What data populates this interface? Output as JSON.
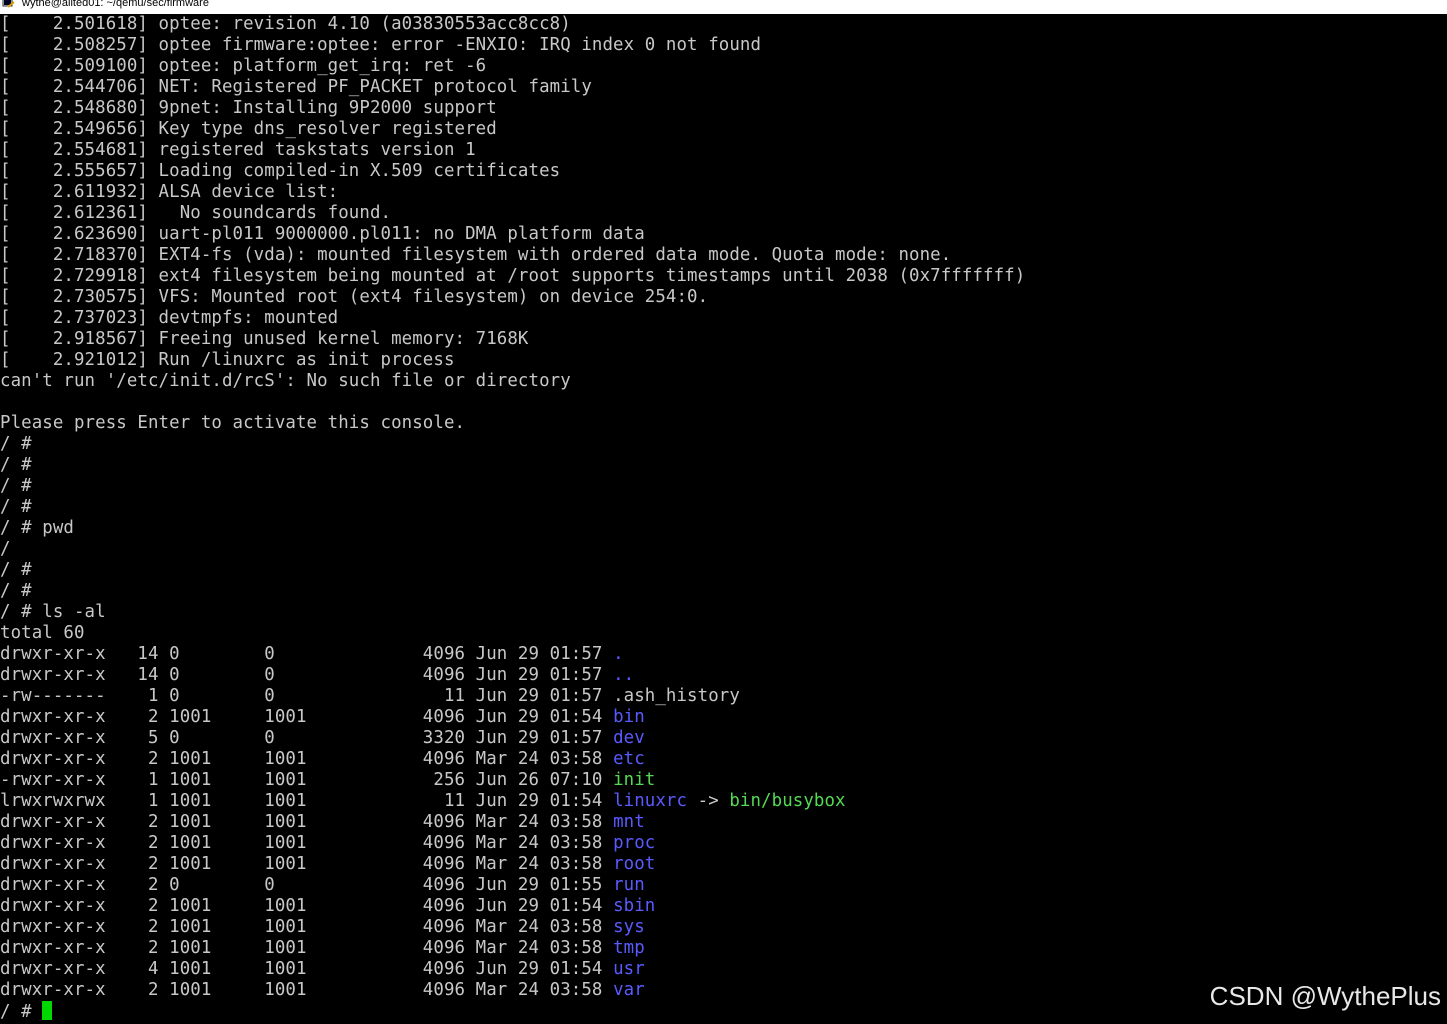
{
  "window": {
    "title": "wythe@alited01: ~/qemu/sec/firmware"
  },
  "terminal": {
    "boot_log": [
      "[    2.501618] optee: revision 4.10 (a03830553acc8cc8)",
      "[    2.508257] optee firmware:optee: error -ENXIO: IRQ index 0 not found",
      "[    2.509100] optee: platform_get_irq: ret -6",
      "[    2.544706] NET: Registered PF_PACKET protocol family",
      "[    2.548680] 9pnet: Installing 9P2000 support",
      "[    2.549656] Key type dns_resolver registered",
      "[    2.554681] registered taskstats version 1",
      "[    2.555657] Loading compiled-in X.509 certificates",
      "[    2.611932] ALSA device list:",
      "[    2.612361]   No soundcards found.",
      "[    2.623690] uart-pl011 9000000.pl011: no DMA platform data",
      "[    2.718370] EXT4-fs (vda): mounted filesystem with ordered data mode. Quota mode: none.",
      "[    2.729918] ext4 filesystem being mounted at /root supports timestamps until 2038 (0x7fffffff)",
      "[    2.730575] VFS: Mounted root (ext4 filesystem) on device 254:0.",
      "[    2.737023] devtmpfs: mounted",
      "[    2.918567] Freeing unused kernel memory: 7168K",
      "[    2.921012] Run /linuxrc as init process",
      "can't run '/etc/init.d/rcS': No such file or directory",
      "",
      "Please press Enter to activate this console.",
      "/ #",
      "/ #",
      "/ #",
      "/ #",
      "/ # pwd",
      "/",
      "/ #",
      "/ #",
      "/ # ls -al",
      "total 60"
    ],
    "listing": [
      {
        "prefix": "drwxr-xr-x   14 0        0              4096 Jun 29 01:57 ",
        "name": ".",
        "kind": "dir"
      },
      {
        "prefix": "drwxr-xr-x   14 0        0              4096 Jun 29 01:57 ",
        "name": "..",
        "kind": "dir"
      },
      {
        "prefix": "-rw-------    1 0        0                11 Jun 29 01:57 ",
        "name": ".ash_history",
        "kind": "file"
      },
      {
        "prefix": "drwxr-xr-x    2 1001     1001           4096 Jun 29 01:54 ",
        "name": "bin",
        "kind": "dir"
      },
      {
        "prefix": "drwxr-xr-x    5 0        0              3320 Jun 29 01:57 ",
        "name": "dev",
        "kind": "dir"
      },
      {
        "prefix": "drwxr-xr-x    2 1001     1001           4096 Mar 24 03:58 ",
        "name": "etc",
        "kind": "dir"
      },
      {
        "prefix": "-rwxr-xr-x    1 1001     1001            256 Jun 26 07:10 ",
        "name": "init",
        "kind": "exec"
      },
      {
        "prefix": "lrwxrwxrwx    1 1001     1001             11 Jun 29 01:54 ",
        "name": "linuxrc",
        "kind": "link",
        "arrow": " -> ",
        "target": "bin/busybox"
      },
      {
        "prefix": "drwxr-xr-x    2 1001     1001           4096 Mar 24 03:58 ",
        "name": "mnt",
        "kind": "dir"
      },
      {
        "prefix": "drwxr-xr-x    2 1001     1001           4096 Mar 24 03:58 ",
        "name": "proc",
        "kind": "dir"
      },
      {
        "prefix": "drwxr-xr-x    2 1001     1001           4096 Mar 24 03:58 ",
        "name": "root",
        "kind": "dir"
      },
      {
        "prefix": "drwxr-xr-x    2 0        0              4096 Jun 29 01:55 ",
        "name": "run",
        "kind": "dir"
      },
      {
        "prefix": "drwxr-xr-x    2 1001     1001           4096 Jun 29 01:54 ",
        "name": "sbin",
        "kind": "dir"
      },
      {
        "prefix": "drwxr-xr-x    2 1001     1001           4096 Mar 24 03:58 ",
        "name": "sys",
        "kind": "dir"
      },
      {
        "prefix": "drwxr-xr-x    2 1001     1001           4096 Mar 24 03:58 ",
        "name": "tmp",
        "kind": "dir"
      },
      {
        "prefix": "drwxr-xr-x    4 1001     1001           4096 Jun 29 01:54 ",
        "name": "usr",
        "kind": "dir"
      },
      {
        "prefix": "drwxr-xr-x    2 1001     1001           4096 Mar 24 03:58 ",
        "name": "var",
        "kind": "dir"
      }
    ],
    "prompt": "/ # ",
    "colors": {
      "background": "#000000",
      "text": "#c8c8c8",
      "directory": "#5a5aff",
      "executable": "#55d955",
      "cursor": "#00d800"
    }
  },
  "watermark": "CSDN @WythePlus"
}
